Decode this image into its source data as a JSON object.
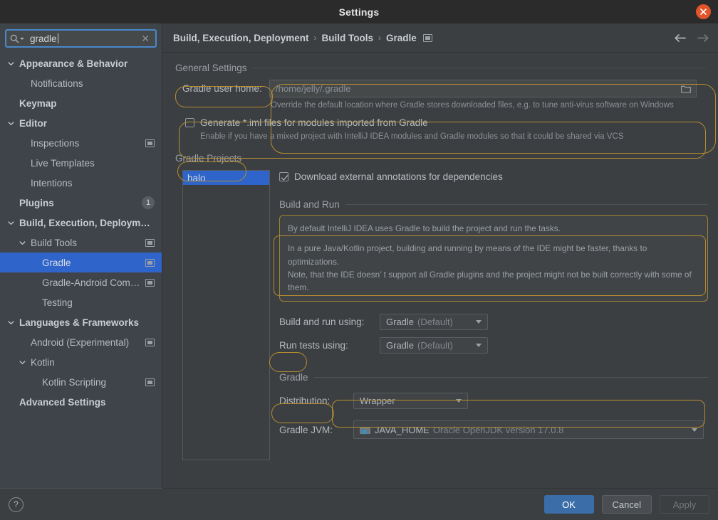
{
  "window": {
    "title": "Settings",
    "close_icon": "close-icon"
  },
  "sidebar": {
    "search": {
      "value": "gradle",
      "icon": "search-icon",
      "clear_icon": "clear-icon"
    },
    "items": [
      {
        "label": "Appearance & Behavior",
        "indent": 0,
        "bold": true,
        "twisty": "down",
        "icon": false,
        "badge": "",
        "selected": false
      },
      {
        "label": "Notifications",
        "indent": 1,
        "bold": false,
        "twisty": "none",
        "icon": false,
        "badge": "",
        "selected": false
      },
      {
        "label": "Keymap",
        "indent": 0,
        "bold": true,
        "twisty": "none",
        "icon": false,
        "badge": "",
        "selected": false
      },
      {
        "label": "Editor",
        "indent": 0,
        "bold": true,
        "twisty": "down",
        "icon": false,
        "badge": "",
        "selected": false
      },
      {
        "label": "Inspections",
        "indent": 1,
        "bold": false,
        "twisty": "none",
        "icon": true,
        "badge": "",
        "selected": false
      },
      {
        "label": "Live Templates",
        "indent": 1,
        "bold": false,
        "twisty": "none",
        "icon": false,
        "badge": "",
        "selected": false
      },
      {
        "label": "Intentions",
        "indent": 1,
        "bold": false,
        "twisty": "none",
        "icon": false,
        "badge": "",
        "selected": false
      },
      {
        "label": "Plugins",
        "indent": 0,
        "bold": true,
        "twisty": "none",
        "icon": false,
        "badge": "1",
        "selected": false
      },
      {
        "label": "Build, Execution, Deployment",
        "indent": 0,
        "bold": true,
        "twisty": "down",
        "icon": false,
        "badge": "",
        "selected": false
      },
      {
        "label": "Build Tools",
        "indent": 1,
        "bold": false,
        "twisty": "down",
        "icon": true,
        "badge": "",
        "selected": false
      },
      {
        "label": "Gradle",
        "indent": 2,
        "bold": false,
        "twisty": "none",
        "icon": true,
        "badge": "",
        "selected": true
      },
      {
        "label": "Gradle-Android Compiler",
        "indent": 2,
        "bold": false,
        "twisty": "none",
        "icon": true,
        "badge": "",
        "selected": false
      },
      {
        "label": "Testing",
        "indent": 2,
        "bold": false,
        "twisty": "none",
        "icon": false,
        "badge": "",
        "selected": false
      },
      {
        "label": "Languages & Frameworks",
        "indent": 0,
        "bold": true,
        "twisty": "down",
        "icon": false,
        "badge": "",
        "selected": false
      },
      {
        "label": "Android (Experimental)",
        "indent": 1,
        "bold": false,
        "twisty": "none",
        "icon": true,
        "badge": "",
        "selected": false
      },
      {
        "label": "Kotlin",
        "indent": 1,
        "bold": false,
        "twisty": "down",
        "icon": false,
        "badge": "",
        "selected": false
      },
      {
        "label": "Kotlin Scripting",
        "indent": 2,
        "bold": false,
        "twisty": "none",
        "icon": true,
        "badge": "",
        "selected": false
      },
      {
        "label": "Advanced Settings",
        "indent": 0,
        "bold": true,
        "twisty": "none",
        "icon": false,
        "badge": "",
        "selected": false
      }
    ]
  },
  "breadcrumb": {
    "parts": [
      "Build, Execution, Deployment",
      "Build Tools",
      "Gradle"
    ],
    "separator": "›",
    "project_icon": "project-scope-icon",
    "back_icon": "arrow-left-icon",
    "forward_icon": "arrow-right-icon"
  },
  "main": {
    "general_settings": {
      "title": "General Settings",
      "gradle_user_home": {
        "label": "Gradle user home:",
        "placeholder": "/home/jelly/.gradle",
        "value": "",
        "browse_icon": "folder-icon",
        "hint": "Override the default location where Gradle stores downloaded files, e.g. to tune anti-virus software on Windows"
      },
      "generate_iml": {
        "label": "Generate *.iml files for modules imported from Gradle",
        "checked": false,
        "hint": "Enable if you have a mixed project with IntelliJ IDEA modules and Gradle modules so that it could be shared via VCS"
      }
    },
    "gradle_projects": {
      "title": "Gradle Projects",
      "projects": [
        "halo"
      ],
      "selected_project": "halo",
      "download_annotations": {
        "label": "Download external annotations for dependencies",
        "checked": true
      },
      "build_and_run": {
        "title": "Build and Run",
        "info_line1": "By default IntelliJ IDEA uses Gradle to build the project and run the tasks.",
        "info_line2": "In a pure Java/Kotlin project, building and running by means of the IDE might be faster, thanks to optimizations.",
        "info_line3": "Note, that the IDE doesn’ t support all Gradle plugins and the project might not be built correctly with some of them.",
        "build_and_run_using": {
          "label": "Build and run using:",
          "value": "Gradle",
          "suffix": "(Default)"
        },
        "run_tests_using": {
          "label": "Run tests using:",
          "value": "Gradle",
          "suffix": "(Default)"
        }
      },
      "gradle": {
        "title": "Gradle",
        "distribution": {
          "label": "Distribution:",
          "value": "Wrapper"
        },
        "gradle_jvm": {
          "label": "Gradle JVM:",
          "icon": "java-home-folder-icon",
          "value": "JAVA_HOME",
          "suffix": "Oracle OpenJDK version 17.0.8"
        }
      }
    }
  },
  "footer": {
    "help_icon": "help-icon",
    "help_label": "?",
    "ok": "OK",
    "cancel": "Cancel",
    "apply": "Apply"
  },
  "colors": {
    "accent_selection": "#2f65ca",
    "highlight_ring": "#b58c32",
    "primary_button": "#3b6ea8",
    "close_button": "#e2542a",
    "panel_bg": "#3c3f41",
    "sidebar_bg": "#3f434a",
    "titlebar_bg": "#2b2b2b"
  }
}
